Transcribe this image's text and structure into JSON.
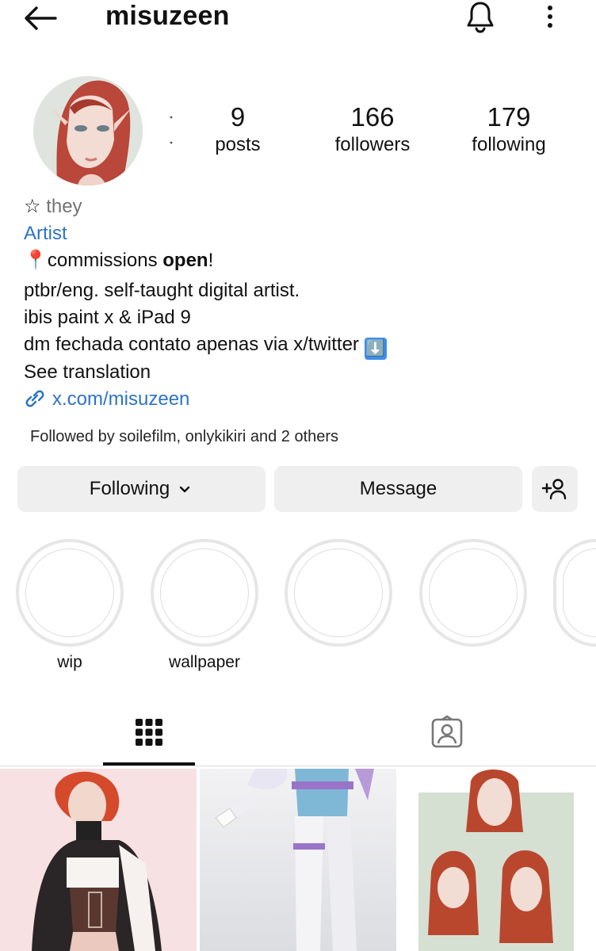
{
  "header": {
    "username": "misuzeen",
    "back_icon": "arrow-left-icon",
    "notification_icon": "bell-icon",
    "more_icon": "more-vertical-icon"
  },
  "stats": [
    {
      "value": "9",
      "label": "posts"
    },
    {
      "value": "166",
      "label": "followers"
    },
    {
      "value": "179",
      "label": "following"
    }
  ],
  "bio": {
    "pronoun_star": "☆",
    "pronouns": "they",
    "category": "Artist",
    "line1_pin": "📍",
    "line1_a": "commissions ",
    "line1_bold": "open",
    "line1_b": "!",
    "line2": "ptbr/eng. self-taught digital artist.",
    "line3": "ibis paint x & iPad 9",
    "line4": "dm fechada contato apenas via x/twitter",
    "line4_emoji": "⬇️",
    "see_translation": "See translation",
    "link": "x.com/misuzeen"
  },
  "followed_by": "Followed by soilefilm, onlykikiri and 2 others",
  "actions": {
    "following_label": "Following",
    "message_label": "Message"
  },
  "highlights": [
    {
      "label": "wip"
    },
    {
      "label": "wallpaper"
    },
    {
      "label": ""
    },
    {
      "label": ""
    },
    {
      "label": ""
    }
  ],
  "tabs": {
    "grid_icon": "grid-icon",
    "tagged_icon": "tagged-person-icon"
  },
  "colors": {
    "link_blue": "#2d73c4",
    "button_bg": "#efefef",
    "muted_text": "#737373"
  }
}
